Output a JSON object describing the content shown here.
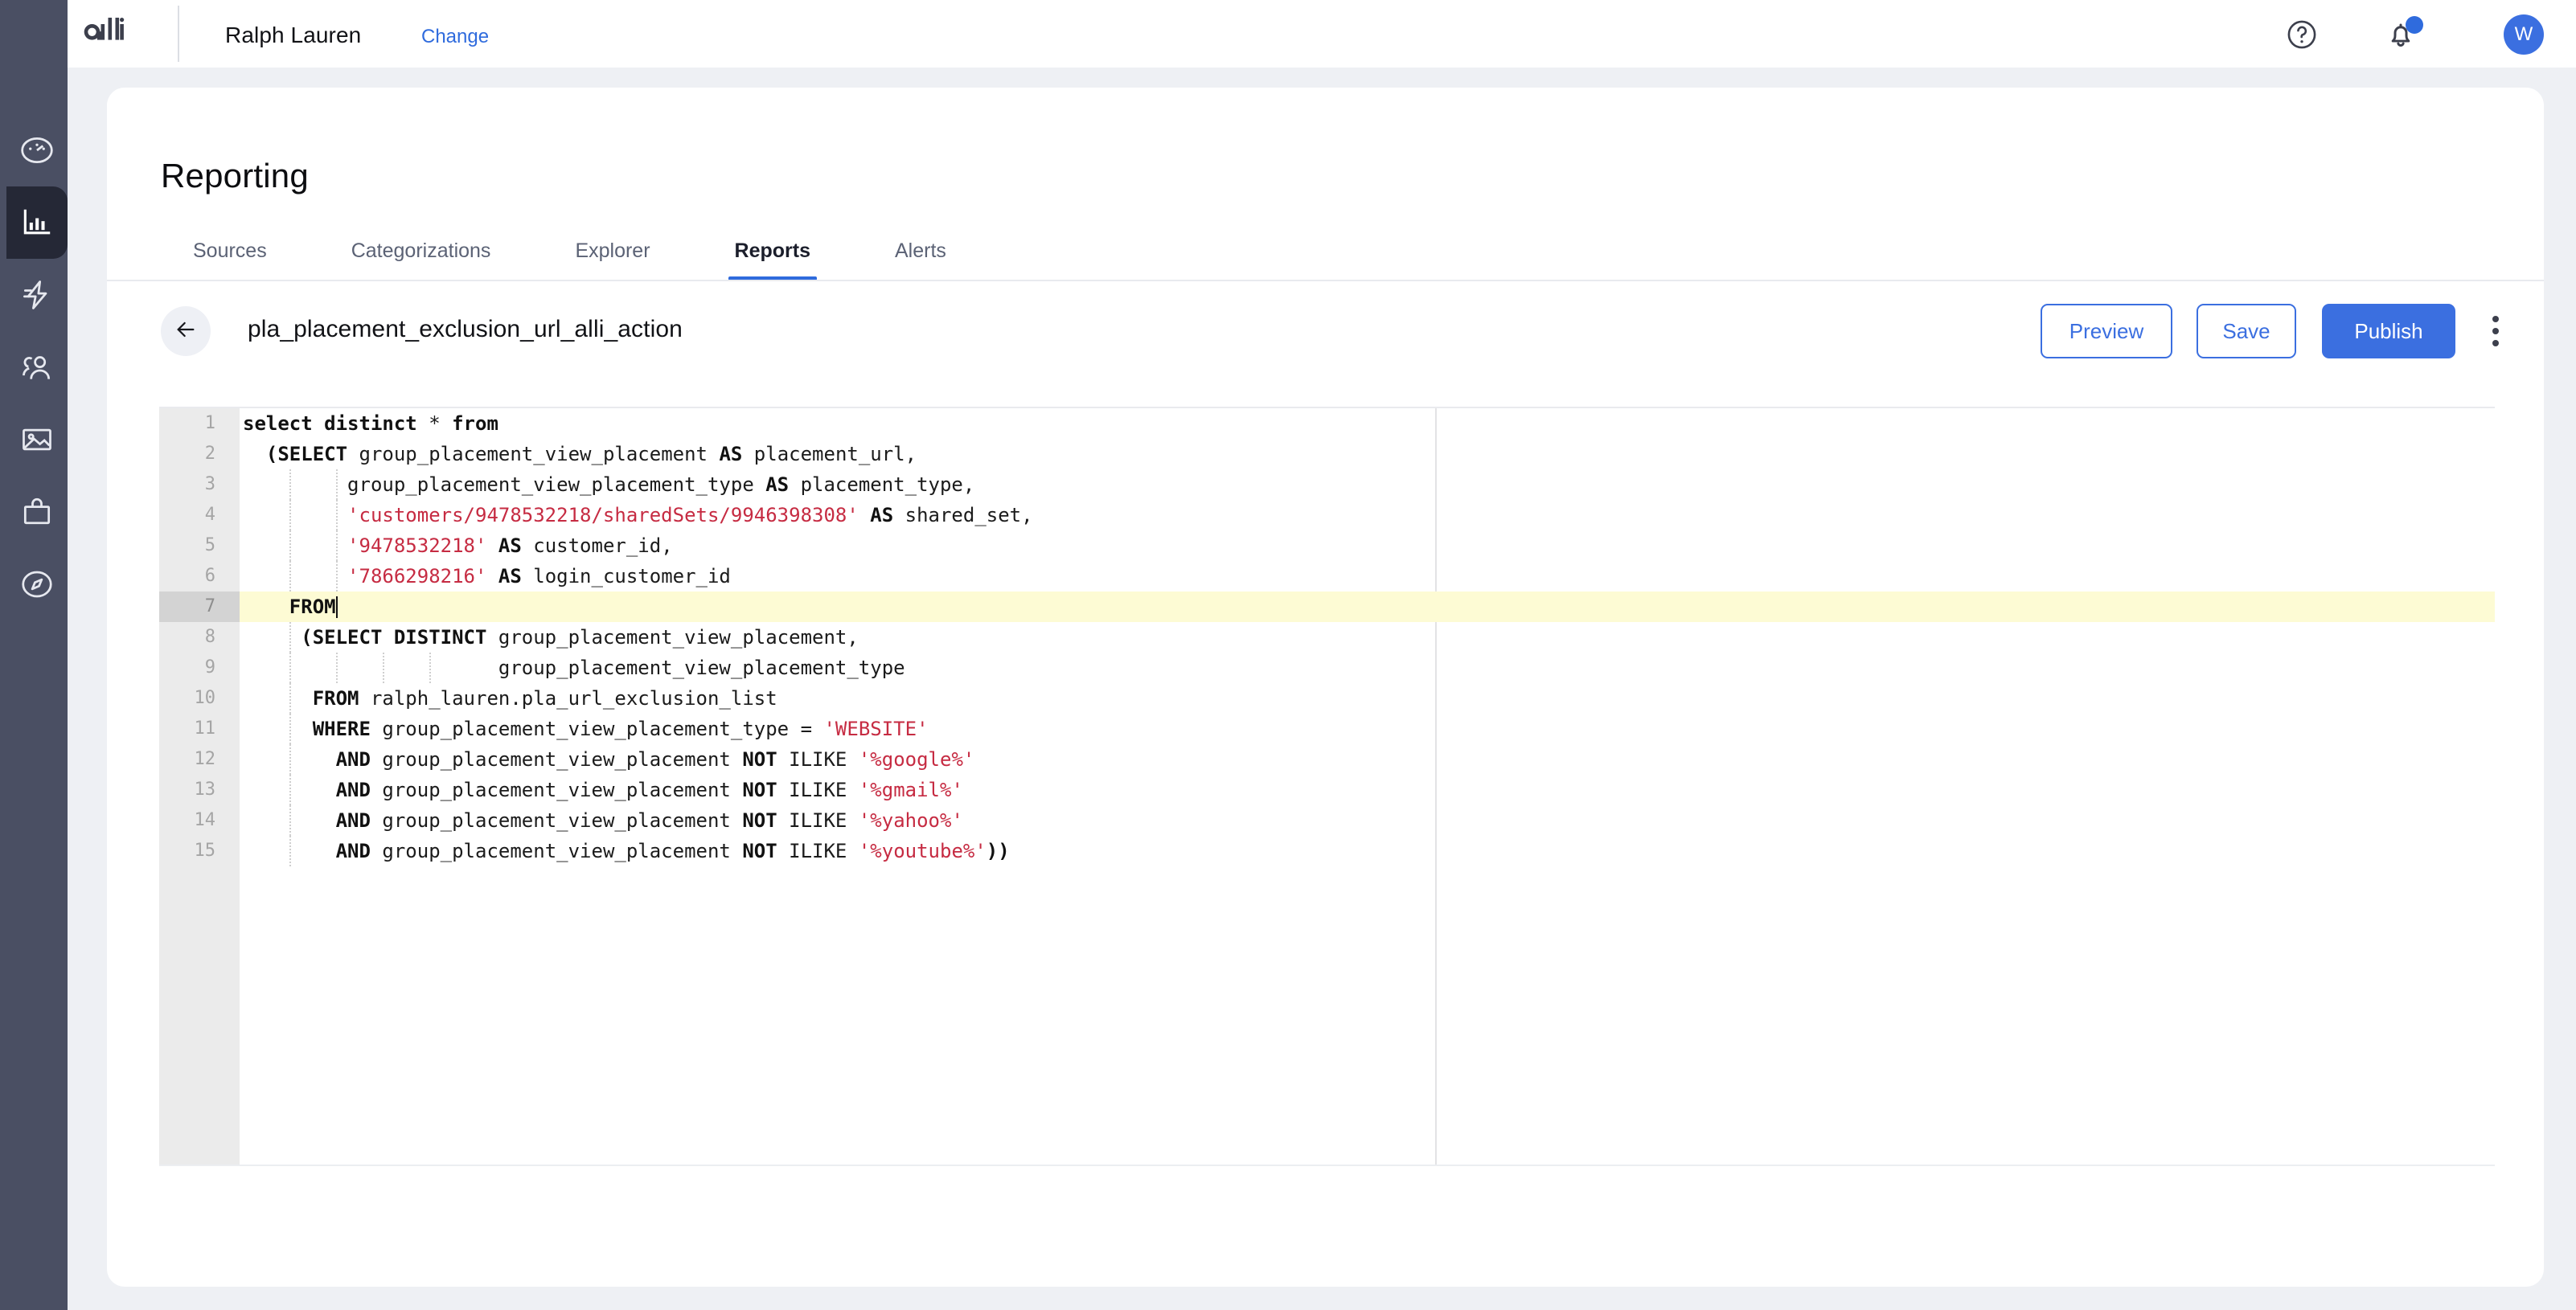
{
  "topbar": {
    "logo_text": "alli",
    "logo_icon": "alli-wordmark",
    "brand_name": "Ralph Lauren",
    "change_label": "Change",
    "help_icon": "help-circle-icon",
    "bell_icon": "notification-bell-icon",
    "bell_has_badge": true,
    "avatar_initial": "W",
    "accent_color": "#3b6fe0"
  },
  "sidebar": {
    "items": [
      {
        "name": "dashboard",
        "icon": "gauge-icon",
        "active": false
      },
      {
        "name": "reporting",
        "icon": "bar-chart-icon",
        "active": true
      },
      {
        "name": "automation",
        "icon": "lightning-bolt-icon",
        "active": false
      },
      {
        "name": "audiences",
        "icon": "users-icon",
        "active": false
      },
      {
        "name": "creative",
        "icon": "image-icon",
        "active": false
      },
      {
        "name": "commerce",
        "icon": "shopping-bag-icon",
        "active": false
      },
      {
        "name": "explore",
        "icon": "compass-icon",
        "active": false
      }
    ],
    "background_color": "#4a4f63",
    "active_color": "#252836"
  },
  "page": {
    "title": "Reporting"
  },
  "tabs": [
    {
      "label": "Sources",
      "active": false
    },
    {
      "label": "Categorizations",
      "active": false
    },
    {
      "label": "Explorer",
      "active": false
    },
    {
      "label": "Reports",
      "active": true
    },
    {
      "label": "Alerts",
      "active": false
    }
  ],
  "report_header": {
    "back_icon": "arrow-left-icon",
    "title": "pla_placement_exclusion_url_alli_action",
    "preview_label": "Preview",
    "save_label": "Save",
    "publish_label": "Publish",
    "menu_icon": "more-vertical-icon"
  },
  "editor": {
    "current_line": 7,
    "fold_lines": [
      2,
      8
    ],
    "line_numbers": [
      1,
      2,
      3,
      4,
      5,
      6,
      7,
      8,
      9,
      10,
      11,
      12,
      13,
      14,
      15
    ],
    "string_color": "#c62b42",
    "current_line_highlight": "#fdfbd4",
    "lines": [
      {
        "n": 1,
        "text": "select distinct * from"
      },
      {
        "n": 2,
        "text": "  (SELECT group_placement_view_placement AS placement_url,"
      },
      {
        "n": 3,
        "text": "         group_placement_view_placement_type AS placement_type,"
      },
      {
        "n": 4,
        "text": "         'customers/9478532218/sharedSets/9946398308' AS shared_set,"
      },
      {
        "n": 5,
        "text": "         '9478532218' AS customer_id,"
      },
      {
        "n": 6,
        "text": "         '7866298216' AS login_customer_id"
      },
      {
        "n": 7,
        "text": "    FROM"
      },
      {
        "n": 8,
        "text": "     (SELECT DISTINCT group_placement_view_placement,"
      },
      {
        "n": 9,
        "text": "                      group_placement_view_placement_type"
      },
      {
        "n": 10,
        "text": "      FROM ralph_lauren.pla_url_exclusion_list"
      },
      {
        "n": 11,
        "text": "      WHERE group_placement_view_placement_type = 'WEBSITE'"
      },
      {
        "n": 12,
        "text": "        AND group_placement_view_placement NOT ILIKE '%google%'"
      },
      {
        "n": 13,
        "text": "        AND group_placement_view_placement NOT ILIKE '%gmail%'"
      },
      {
        "n": 14,
        "text": "        AND group_placement_view_placement NOT ILIKE '%yahoo%'"
      },
      {
        "n": 15,
        "text": "        AND group_placement_view_placement NOT ILIKE '%youtube%'))"
      }
    ]
  }
}
